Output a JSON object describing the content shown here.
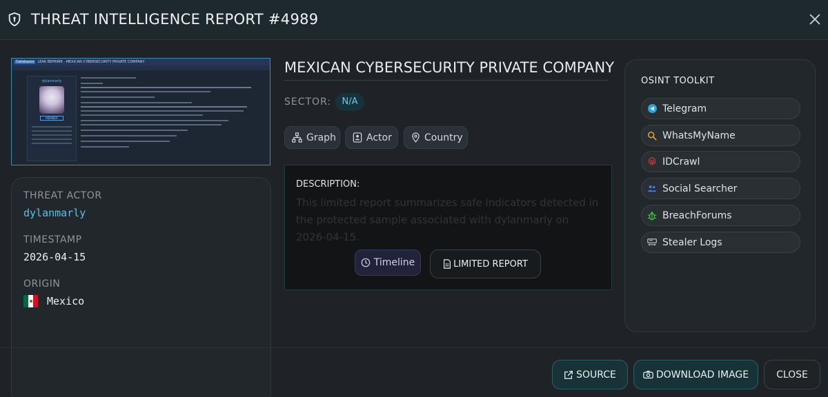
{
  "header": {
    "title": "THREAT INTELLIGENCE REPORT #4989",
    "shield_icon": "shield-icon",
    "close_icon": "close-icon"
  },
  "screenshot": {
    "forum_tag": "Databases",
    "forum_title": "LEAK BEPRIME - MEXICAN CYBERSECURITY PRIVATE COMPANY",
    "forum_user": "dylanmarly",
    "member_label": "MEMBER"
  },
  "actor_panel": {
    "threat_actor_label": "THREAT ACTOR",
    "threat_actor": "dylanmarly",
    "timestamp_label": "TIMESTAMP",
    "timestamp": "2026-04-15",
    "origin_label": "ORIGIN",
    "origin": "Mexico"
  },
  "report": {
    "title": "MEXICAN CYBERSECURITY PRIVATE COMPANY",
    "sector_label": "SECTOR:",
    "sector": "N/A",
    "pills": [
      {
        "label": "Graph",
        "icon": "graph-icon"
      },
      {
        "label": "Actor",
        "icon": "actor-icon"
      },
      {
        "label": "Country",
        "icon": "location-pin-icon"
      }
    ]
  },
  "description": {
    "label": "DESCRIPTION:",
    "text": "This limited report summarizes safe indicators detected in the protected sample associated with dylanmarly on 2026-04-15.",
    "timeline_label": "Timeline",
    "limited_label": "LIMITED REPORT"
  },
  "osint": {
    "title": "OSINT TOOLKIT",
    "tools": [
      {
        "label": "Telegram",
        "icon": "telegram-icon",
        "color": "#2aa3df"
      },
      {
        "label": "WhatsMyName",
        "icon": "magnifier-icon",
        "color": "#e0a32a"
      },
      {
        "label": "IDCrawl",
        "icon": "fingerprint-icon",
        "color": "#d0403a"
      },
      {
        "label": "Social Searcher",
        "icon": "people-icon",
        "color": "#3f7fe6"
      },
      {
        "label": "BreachForums",
        "icon": "bug-icon",
        "color": "#3fbf4a"
      },
      {
        "label": "Stealer Logs",
        "icon": "terminal-icon",
        "color": "#c9ced2"
      }
    ]
  },
  "footer": {
    "source_label": "SOURCE",
    "download_label": "DOWNLOAD IMAGE",
    "close_label": "CLOSE"
  },
  "colors": {
    "accent": "#6fc7dd",
    "actor_name": "#5bc0e6",
    "flag_green": "#006847",
    "flag_red": "#ce1126"
  }
}
